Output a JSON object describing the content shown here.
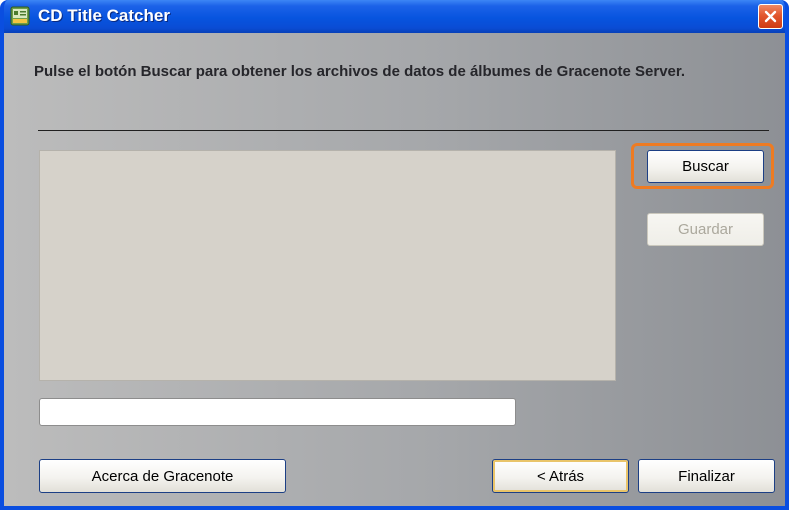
{
  "window": {
    "title": "CD Title Catcher",
    "app_icon": "cd-catcher-app-icon",
    "close_icon": "close-icon"
  },
  "instruction": "Pulse el botón Buscar para obtener los archivos de datos de álbumes de Gracenote Server.",
  "results_list": {
    "items": []
  },
  "progress": {
    "value": 0
  },
  "buttons": {
    "search": "Buscar",
    "save": "Guardar",
    "about": "Acerca de Gracenote",
    "back": "< Atrás",
    "finish": "Finalizar"
  },
  "colors": {
    "titlebar": "#0754df",
    "close_button": "#e2562d",
    "highlight": "#ee7b22",
    "list_background": "#d6d2ca"
  }
}
